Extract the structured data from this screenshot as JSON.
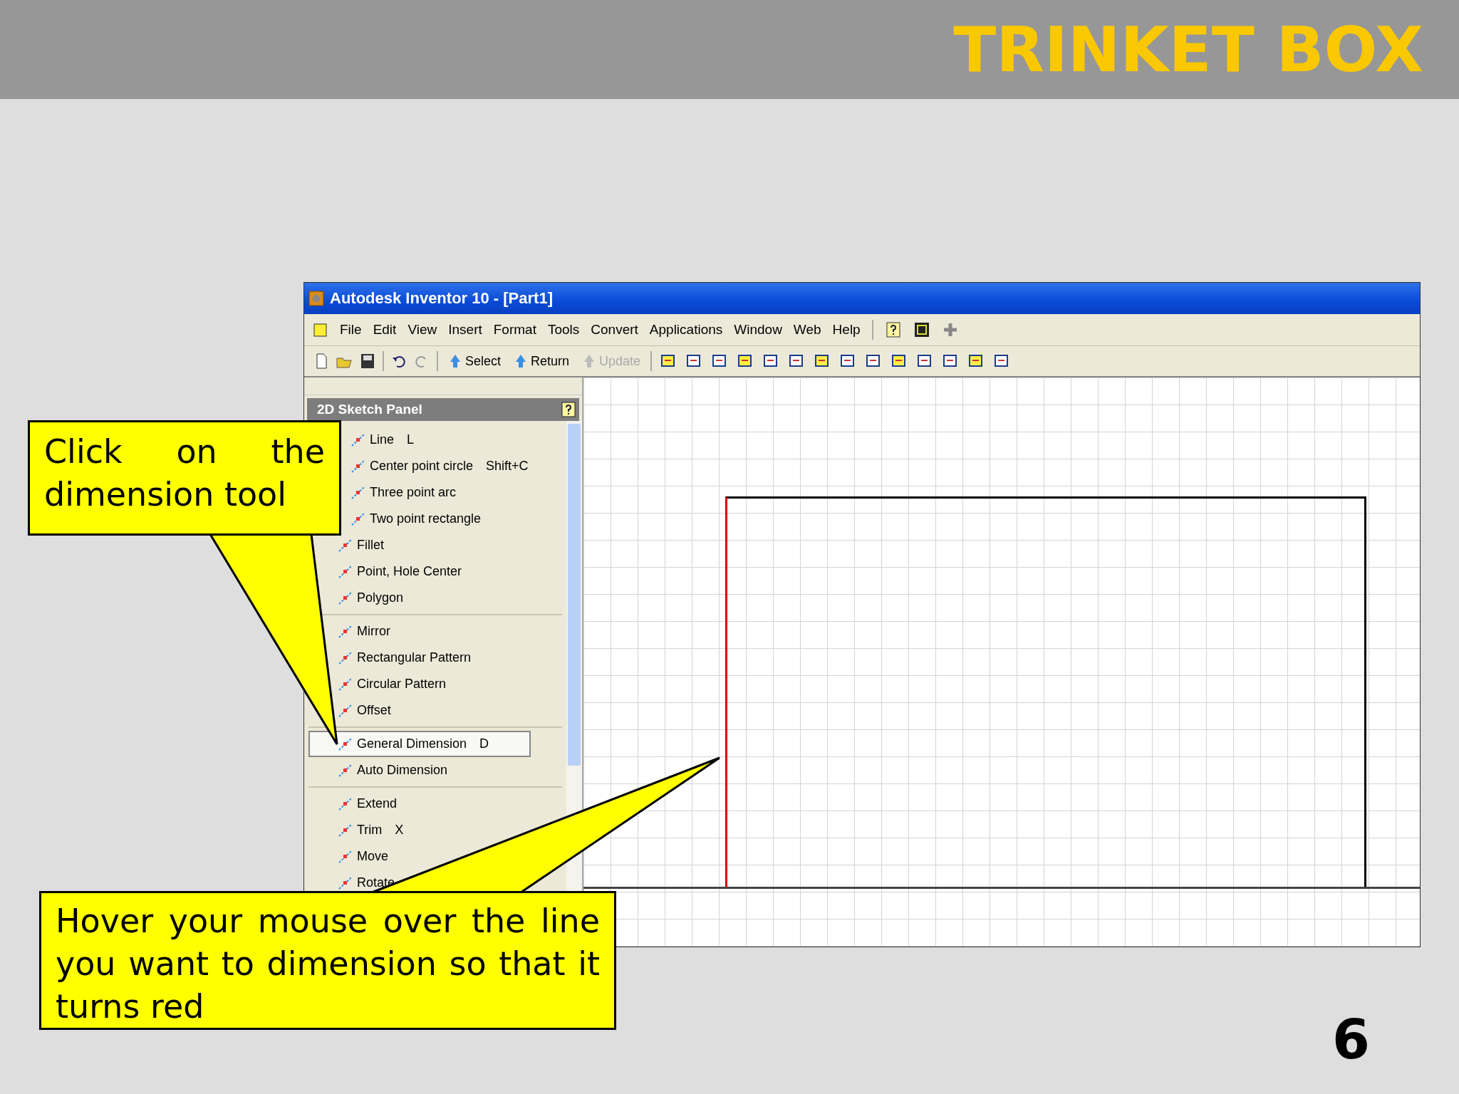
{
  "slide": {
    "title": "TRINKET BOX",
    "page_number": "6"
  },
  "window": {
    "title": "Autodesk Inventor 10 - [Part1]"
  },
  "menu": [
    "File",
    "Edit",
    "View",
    "Insert",
    "Format",
    "Tools",
    "Convert",
    "Applications",
    "Window",
    "Web",
    "Help"
  ],
  "toolbar": [
    {
      "label": "Select",
      "disabled": false
    },
    {
      "label": "Return",
      "disabled": false
    },
    {
      "label": "Update",
      "disabled": true
    }
  ],
  "panel": {
    "title": "2D Sketch Panel",
    "groups": [
      [
        {
          "label": "Line",
          "shortcut": "L",
          "selected": false
        },
        {
          "label": "Center point circle",
          "shortcut": "Shift+C",
          "selected": false
        },
        {
          "label": "Three point arc",
          "selected": false
        },
        {
          "label": "Two point rectangle",
          "selected": false
        },
        {
          "label": "Fillet",
          "selected": false
        },
        {
          "label": "Point, Hole Center",
          "selected": false
        },
        {
          "label": "Polygon",
          "selected": false
        }
      ],
      [
        {
          "label": "Mirror",
          "selected": false
        },
        {
          "label": "Rectangular Pattern",
          "selected": false
        },
        {
          "label": "Circular Pattern",
          "selected": false
        },
        {
          "label": "Offset",
          "selected": false
        }
      ],
      [
        {
          "label": "General Dimension",
          "shortcut": "D",
          "selected": true
        },
        {
          "label": "Auto Dimension",
          "selected": false
        }
      ],
      [
        {
          "label": "Extend",
          "selected": false
        },
        {
          "label": "Trim",
          "shortcut": "X",
          "selected": false
        },
        {
          "label": "Move",
          "selected": false
        },
        {
          "label": "Rotate",
          "selected": false
        }
      ]
    ]
  },
  "sketch": {
    "left_edge_highlighted": true
  },
  "callouts": [
    "Click on the dimension tool",
    "Hover your mouse over the line you want to dimension so that it turns red"
  ]
}
